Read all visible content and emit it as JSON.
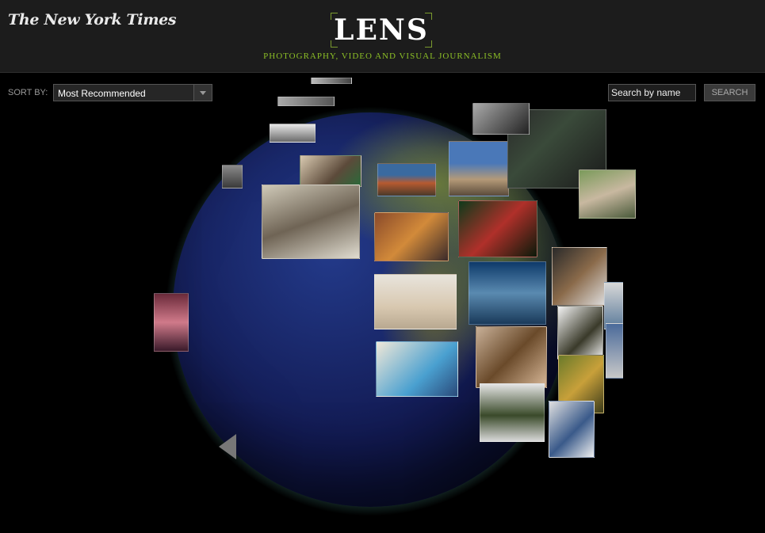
{
  "header": {
    "nyt_logo": "The New York Times",
    "title": "LENS",
    "tagline": "PHOTOGRAPHY, VIDEO AND VISUAL JOURNALISM"
  },
  "controls": {
    "sort_label": "SORT BY:",
    "sort_value": "Most Recommended",
    "search_placeholder": "Search by name",
    "search_button": "SEARCH"
  },
  "colors": {
    "accent_green": "#8cbf26",
    "header_bg": "#1c1c1c",
    "globe_glow": "#5ab4aa"
  },
  "globe": {
    "photos": [
      {
        "subject": "wedding group"
      },
      {
        "subject": "ice cave"
      },
      {
        "subject": "lobster on table"
      },
      {
        "subject": "toy figures"
      },
      {
        "subject": "city skyline"
      },
      {
        "subject": "christmas scene"
      },
      {
        "subject": "baby on bed"
      },
      {
        "subject": "heron in flight"
      },
      {
        "subject": "man in tank top"
      },
      {
        "subject": "child portrait"
      },
      {
        "subject": "two boys"
      },
      {
        "subject": "tree branch"
      },
      {
        "subject": "dancers"
      },
      {
        "subject": "sunset sky"
      }
    ]
  }
}
